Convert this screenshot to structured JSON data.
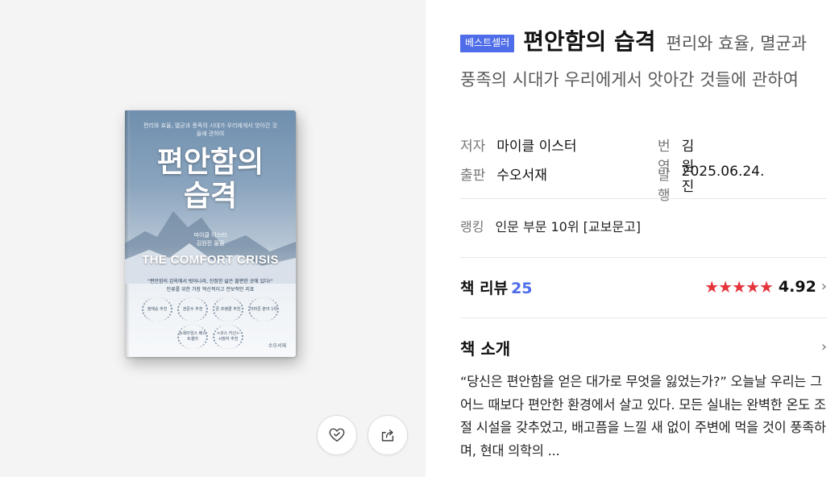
{
  "cover": {
    "top_text": "편리와 효율, 멸균과 풍족의 시대가 우리에게서 앗아간 것들에 관하여",
    "title_line1": "편안함의",
    "title_line2": "습격",
    "author_line": "마이클 이스터",
    "translator_line": "김원진 옮김",
    "english_title": "THE COMFORT CRISIS",
    "quote": "\"편안함의 감옥에서 벗어나라, 진정한 삶은 불편한 곳에 있다!\"",
    "quote_sub": "인류를 위한 가장 혁신적이고 전보적인 지표",
    "badges": [
      "정재승 추천",
      "권준수 추천",
      "존 프랭클 추천",
      "아마존 분야 1위",
      "뉴욕타임스 베스트셀러",
      "<코스 키넌> 시청자 추천"
    ],
    "publisher": "수오서재"
  },
  "actions": {
    "like_icon": "heart-check-icon",
    "share_icon": "share-icon"
  },
  "product": {
    "badge": "베스트셀러",
    "title": "편안함의 습격",
    "subtitle": "편리와 효율, 멸균과 풍족의 시대가 우리에게서 앗아간 것들에 관하여"
  },
  "meta": {
    "author_label": "저자",
    "author": "마이클 이스터",
    "translator_label": "번역",
    "translator": "김원진",
    "publisher_label": "출판",
    "publisher": "수오서재",
    "date_label": "발행",
    "date": "2025.06.24."
  },
  "ranking": {
    "label": "랭킹",
    "value": "인문 부문 10위 [교보문고]"
  },
  "reviews": {
    "label": "책 리뷰",
    "count": "25",
    "stars": "★★★★★",
    "rating": "4.92",
    "star_color": "#e4343c"
  },
  "intro": {
    "label": "책 소개",
    "text": "“당신은 편안함을 얻은 대가로 무엇을 잃었는가?” 오늘날 우리는 그 어느 때보다 편안한 환경에서 살고 있다. 모든 실내는 완벽한 온도 조절 시설을 갖추었고, 배고픔을 느낄 새 없이 주변에 먹을 것이 풍족하며, 현대 의학의 ..."
  },
  "colors": {
    "accent": "#4f6de8",
    "left_bg": "#f4f4f4"
  }
}
